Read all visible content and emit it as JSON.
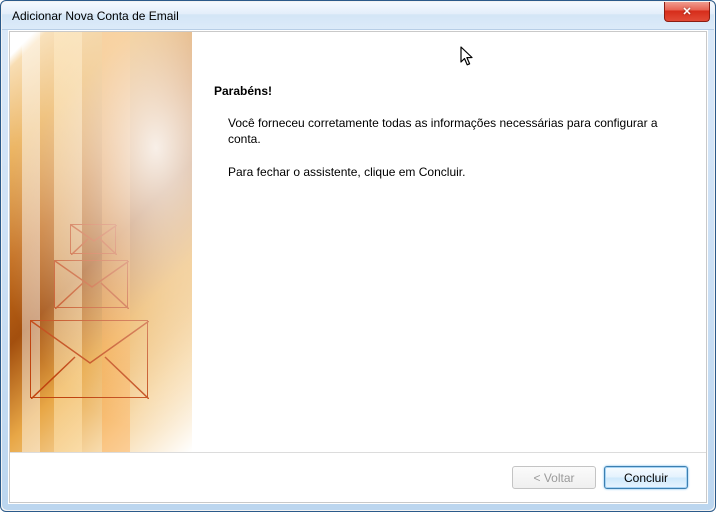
{
  "window": {
    "title": "Adicionar Nova Conta de Email",
    "close_glyph": "✕"
  },
  "content": {
    "heading": "Parabéns!",
    "line1": "Você forneceu corretamente todas as informações necessárias para configurar a conta.",
    "line2": "Para fechar o assistente, clique em Concluir."
  },
  "buttons": {
    "back": "< Voltar",
    "finish": "Concluir"
  }
}
